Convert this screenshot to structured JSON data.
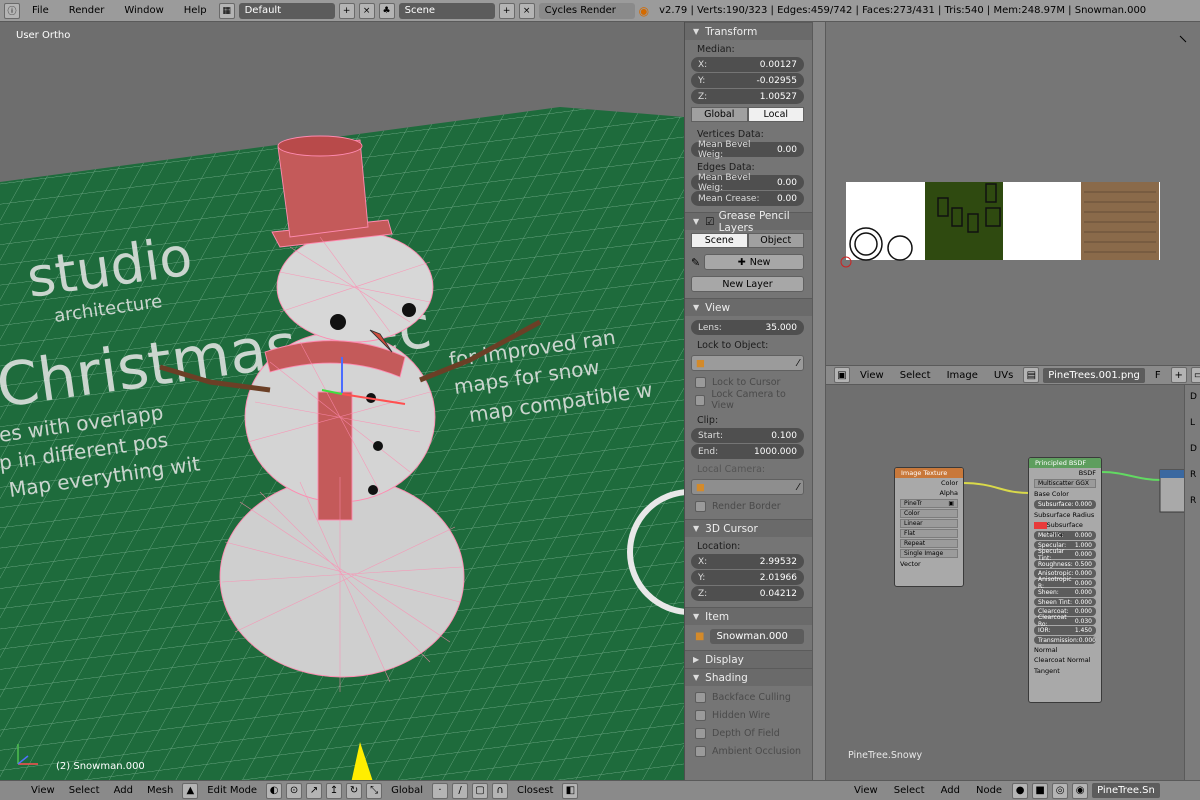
{
  "topbar": {
    "menus": [
      "File",
      "Render",
      "Window",
      "Help"
    ],
    "layout": "Default",
    "scene": "Scene",
    "engine": "Cycles Render",
    "stats": "v2.79 | Verts:190/323 | Edges:459/742 | Faces:273/431 | Tris:540 | Mem:248.97M | Snowman.000"
  },
  "viewport": {
    "view_label": "User Ortho",
    "object_label": "(2) Snowman.000",
    "bg_text": [
      "studio",
      "architecture",
      "Christmas Dec",
      "for improved ran",
      "maps for snow",
      "map compatible w",
      "es with overlapp",
      "p in different pos",
      "Map everything wit"
    ]
  },
  "props": {
    "transform_title": "Transform",
    "median_label": "Median:",
    "x": {
      "k": "X:",
      "v": "0.00127"
    },
    "y": {
      "k": "Y:",
      "v": "-0.02955"
    },
    "z": {
      "k": "Z:",
      "v": "1.00527"
    },
    "global": "Global",
    "local": "Local",
    "vertices_data": "Vertices Data:",
    "mean_bevel_v": {
      "k": "Mean Bevel Weig:",
      "v": "0.00"
    },
    "edges_data": "Edges Data:",
    "mean_bevel_e": {
      "k": "Mean Bevel Weig:",
      "v": "0.00"
    },
    "mean_crease": {
      "k": "Mean Crease:",
      "v": "0.00"
    },
    "grease_title": "Grease Pencil Layers",
    "scene": "Scene",
    "object": "Object",
    "new": "New",
    "new_layer": "New Layer",
    "view_title": "View",
    "lens": {
      "k": "Lens:",
      "v": "35.000"
    },
    "lock_to_object": "Lock to Object:",
    "lock_to_cursor": "Lock to Cursor",
    "lock_camera": "Lock Camera to View",
    "clip": "Clip:",
    "start": {
      "k": "Start:",
      "v": "0.100"
    },
    "end": {
      "k": "End:",
      "v": "1000.000"
    },
    "local_camera": "Local Camera:",
    "render_border": "Render Border",
    "cursor_title": "3D Cursor",
    "location": "Location:",
    "cx": {
      "k": "X:",
      "v": "2.99532"
    },
    "cy": {
      "k": "Y:",
      "v": "2.01966"
    },
    "cz": {
      "k": "Z:",
      "v": "0.04212"
    },
    "item_title": "Item",
    "item_name": "Snowman.000",
    "display_title": "Display",
    "shading_title": "Shading",
    "backface": "Backface Culling",
    "hidden_wire": "Hidden Wire",
    "dof": "Depth Of Field",
    "ao": "Ambient Occlusion"
  },
  "viewbar": {
    "items": [
      "View",
      "Select",
      "Add",
      "Mesh"
    ],
    "mode": "Edit Mode",
    "orientation": "Global",
    "snap": "Closest"
  },
  "imagebar": {
    "items": [
      "View",
      "Select",
      "Image",
      "UVs"
    ],
    "file": "PineTrees.001.png",
    "f": "F"
  },
  "nodes": {
    "tree_name": "PineTree.Snowy",
    "image_texture": {
      "title": "Image Texture",
      "color": "Color",
      "alpha": "Alpha",
      "img": "PineTr",
      "opts": [
        "Color",
        "Linear",
        "Flat",
        "Repeat",
        "Single Image"
      ],
      "vector": "Vector"
    },
    "bsdf": {
      "title": "Principled BSDF",
      "out": "BSDF",
      "dist": "Multiscatter GGX",
      "base_color": "Base Color",
      "subsurface": {
        "k": "Subsurface:",
        "v": "0.000"
      },
      "ss_radius": "Subsurface Radius",
      "ss_color": "Subsurface Color",
      "metallic": {
        "k": "Metallic:",
        "v": "0.000"
      },
      "specular": {
        "k": "Specular:",
        "v": "1.000"
      },
      "spec_tint": {
        "k": "Specular Tint:",
        "v": "0.000"
      },
      "roughness": {
        "k": "Roughness:",
        "v": "0.500"
      },
      "anisotropic": {
        "k": "Anisotropic:",
        "v": "0.000"
      },
      "aniso_rot": {
        "k": "Anisotropic R:",
        "v": "0.000"
      },
      "sheen": {
        "k": "Sheen:",
        "v": "0.000"
      },
      "sheen_tint": {
        "k": "Sheen Tint:",
        "v": "0.000"
      },
      "clearcoat": {
        "k": "Clearcoat:",
        "v": "0.000"
      },
      "cc_rough": {
        "k": "Clearcoat Ro:",
        "v": "0.030"
      },
      "ior": {
        "k": "IOR:",
        "v": "1.450"
      },
      "transmission": {
        "k": "Transmission:",
        "v": "0.000"
      },
      "normal": "Normal",
      "cc_normal": "Clearcoat Normal",
      "tangent": "Tangent"
    }
  },
  "nodebar": {
    "items": [
      "View",
      "Select",
      "Add",
      "Node"
    ],
    "material": "PineTree.Sn"
  },
  "colors": {
    "grass": "#1e6b3c",
    "snow": "#d4d4d4",
    "red": "#c45a5a",
    "wire": "#ff8ab0"
  }
}
